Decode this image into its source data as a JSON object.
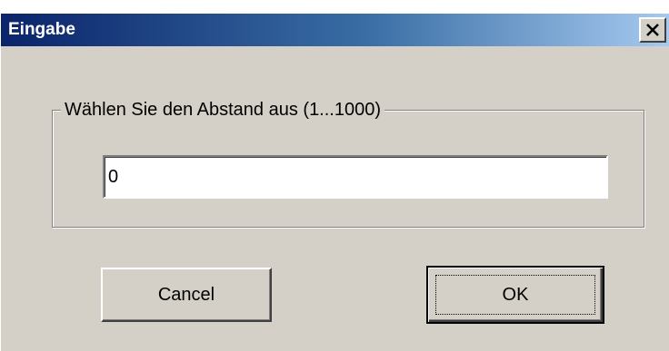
{
  "window": {
    "title": "Eingabe",
    "close_icon": "close-icon"
  },
  "group": {
    "legend": "Wählen Sie den Abstand aus (1...1000)"
  },
  "input": {
    "value": "0"
  },
  "buttons": {
    "cancel_label": "Cancel",
    "ok_label": "OK"
  },
  "colors": {
    "titlebar_start": "#0a246a",
    "titlebar_end": "#a6caf0",
    "window_bg": "#d4d0c8"
  }
}
